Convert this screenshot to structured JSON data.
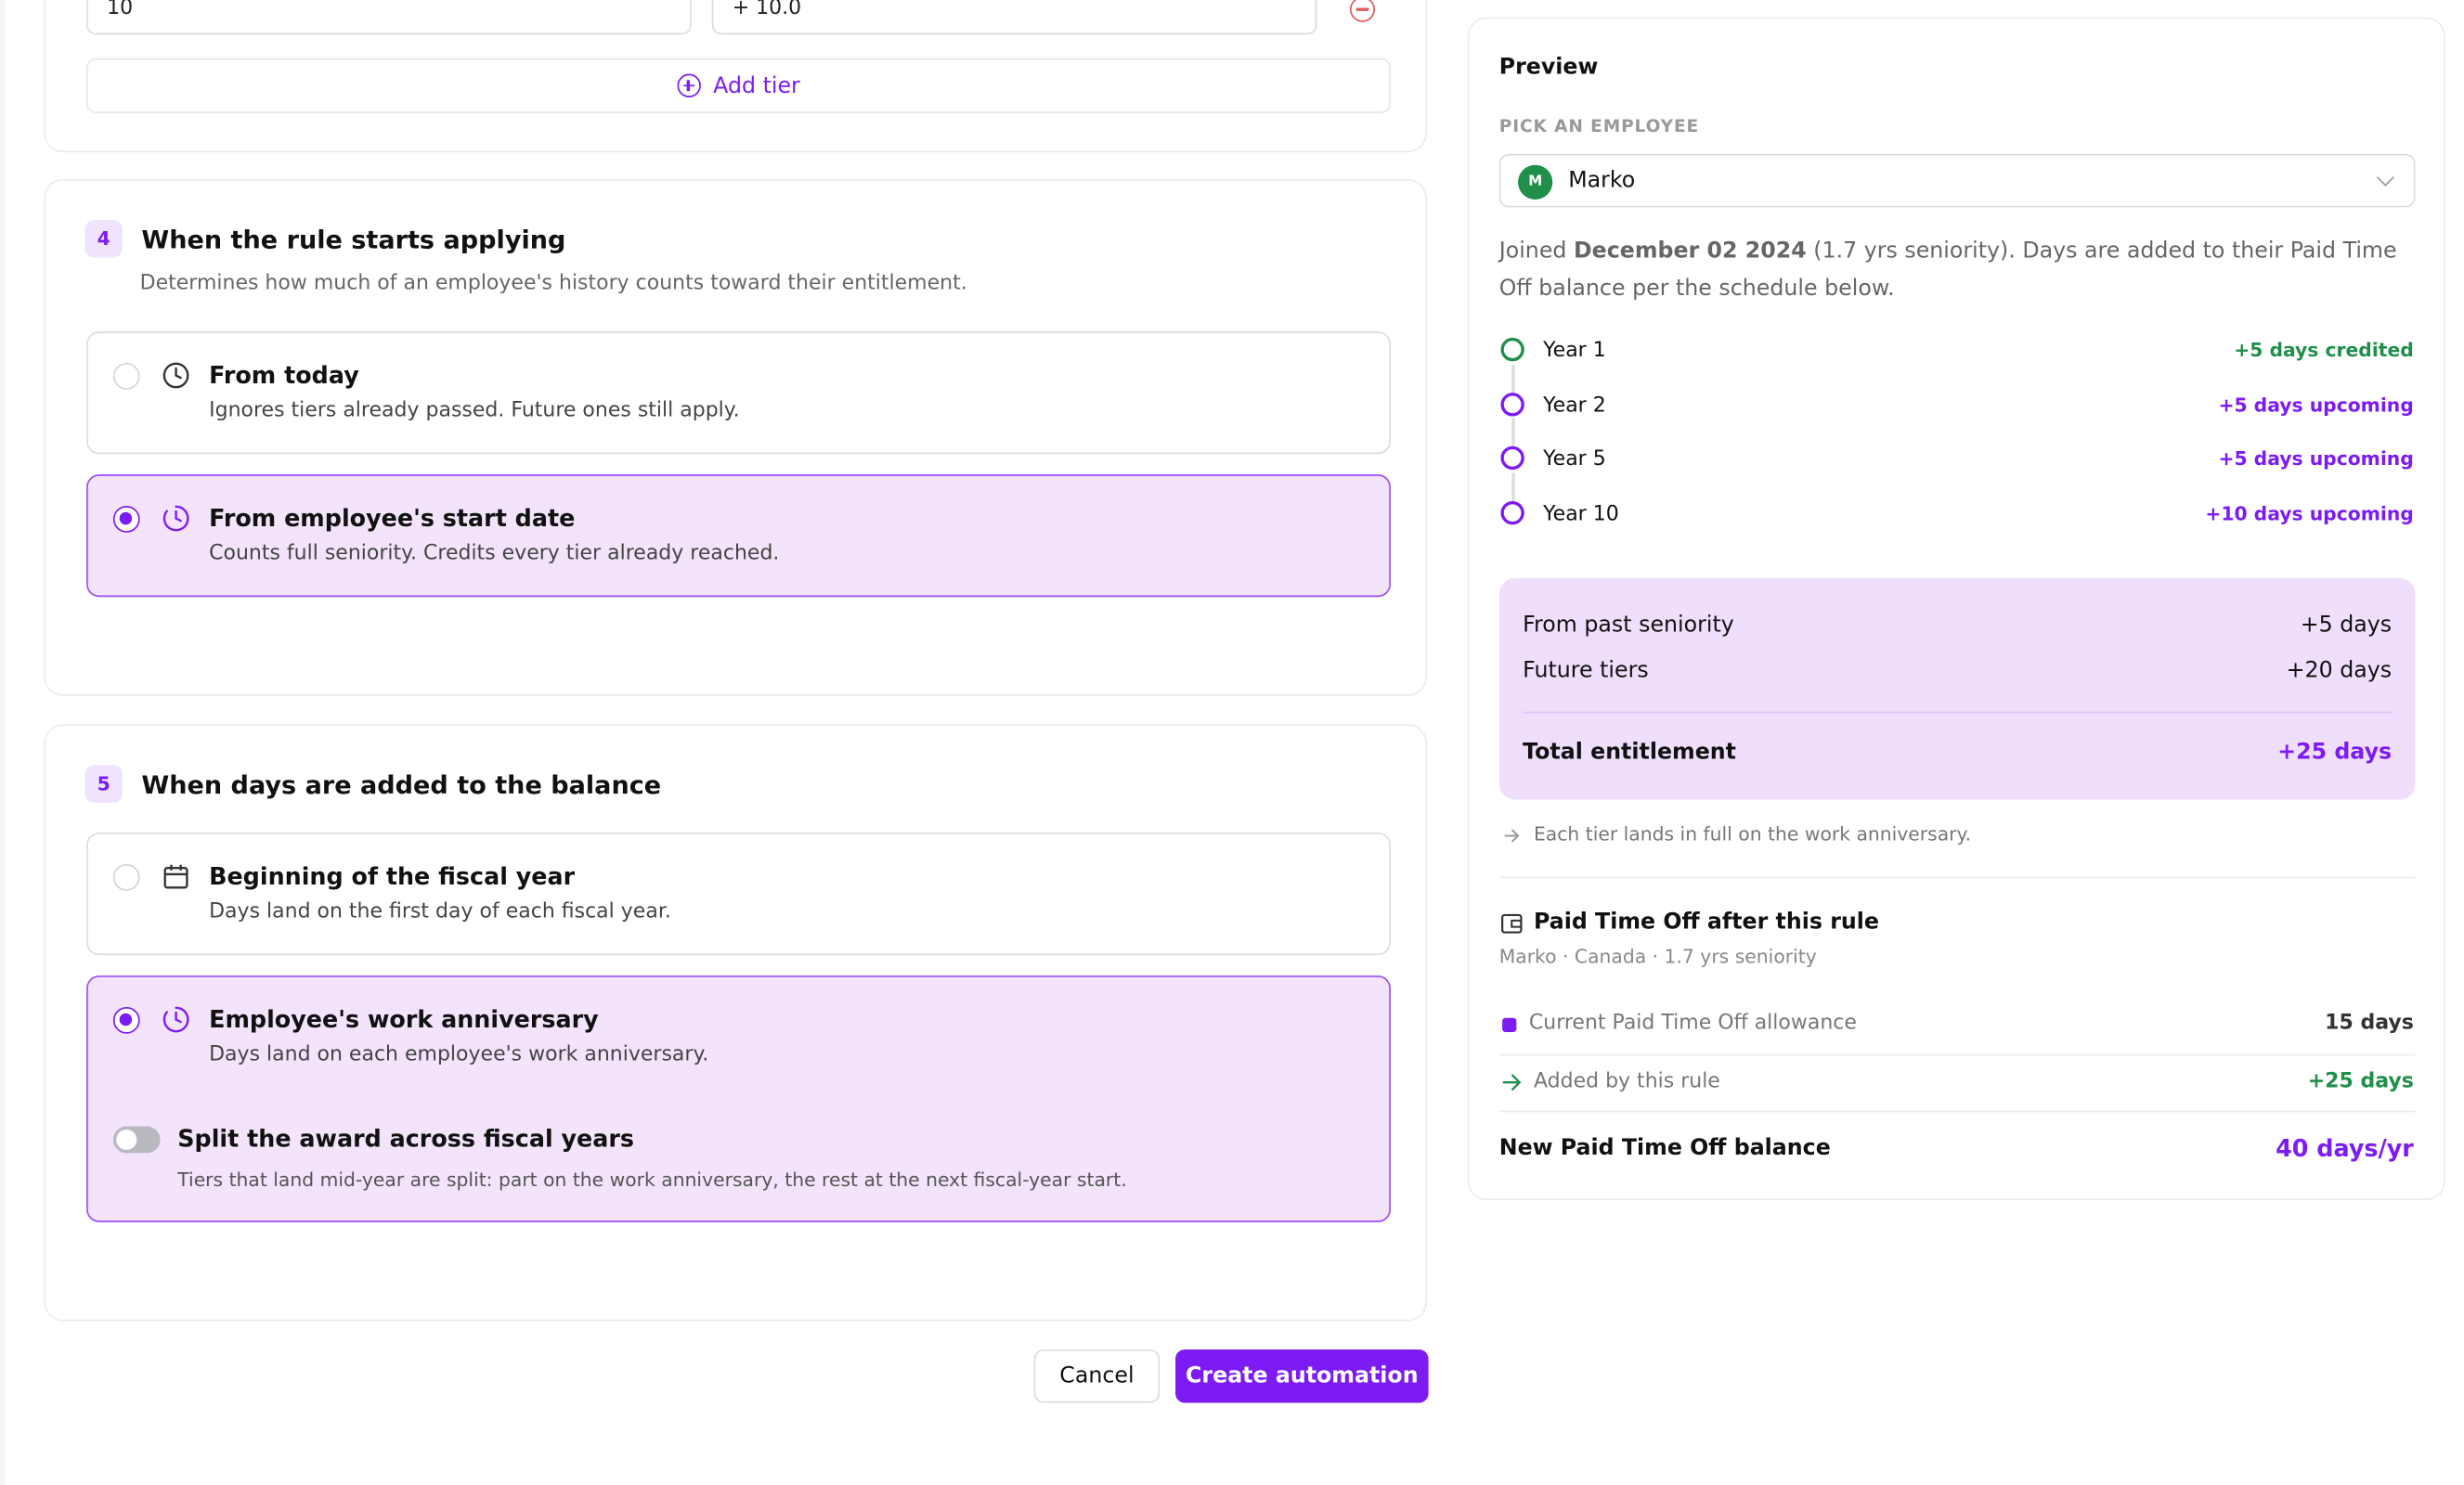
{
  "tiers": {
    "last_row_years": "10",
    "last_row_days": "+ 10.0",
    "add_tier_label": "Add tier"
  },
  "section4": {
    "number": "4",
    "title": "When the rule starts applying",
    "description": "Determines how much of an employee's history counts toward their entitlement.",
    "options": [
      {
        "title": "From today",
        "description": "Ignores tiers already passed. Future ones still apply.",
        "selected": false
      },
      {
        "title": "From employee's start date",
        "description": "Counts full seniority. Credits every tier already reached.",
        "selected": true
      }
    ]
  },
  "section5": {
    "number": "5",
    "title": "When days are added to the balance",
    "options": [
      {
        "title": "Beginning of the fiscal year",
        "description": "Days land on the first day of each fiscal year.",
        "selected": false
      },
      {
        "title": "Employee's work anniversary",
        "description": "Days land on each employee's work anniversary.",
        "selected": true
      }
    ],
    "split": {
      "title": "Split the award across fiscal years",
      "description": "Tiers that land mid-year are split: part on the work anniversary, the rest at the next fiscal-year start.",
      "enabled": false
    }
  },
  "actions": {
    "cancel": "Cancel",
    "create": "Create automation"
  },
  "preview": {
    "title": "Preview",
    "pick_label": "PICK AN EMPLOYEE",
    "employee": {
      "initial": "M",
      "name": "Marko"
    },
    "joined_prefix": "Joined",
    "joined_date": "December 02 2024",
    "joined_suffix": "(1.7 yrs seniority). Days are added to their Paid Time Off balance per the schedule below.",
    "timeline": [
      {
        "label": "Year 1",
        "status": "+5 days credited",
        "state": "credited"
      },
      {
        "label": "Year 2",
        "status": "+5 days upcoming",
        "state": "upcoming"
      },
      {
        "label": "Year 5",
        "status": "+5 days upcoming",
        "state": "upcoming"
      },
      {
        "label": "Year 10",
        "status": "+10 days upcoming",
        "state": "upcoming"
      }
    ],
    "summary": {
      "past_label": "From past seniority",
      "past_value": "+5 days",
      "future_label": "Future tiers",
      "future_value": "+20 days",
      "total_label": "Total entitlement",
      "total_value": "+25 days"
    },
    "note": "Each tier lands in full on the work anniversary.",
    "pto": {
      "title": "Paid Time Off after this rule",
      "subtitle": "Marko · Canada · 1.7 yrs seniority",
      "current_label": "Current Paid Time Off allowance",
      "current_value": "15 days",
      "added_label": "Added by this rule",
      "added_value": "+25 days",
      "new_label": "New Paid Time Off balance",
      "new_value": "40 days/yr"
    }
  },
  "colors": {
    "accent": "#7d1bf5",
    "selected_bg": "#f3e4fc",
    "success": "#1f8f4a",
    "danger": "#e05a5a"
  }
}
